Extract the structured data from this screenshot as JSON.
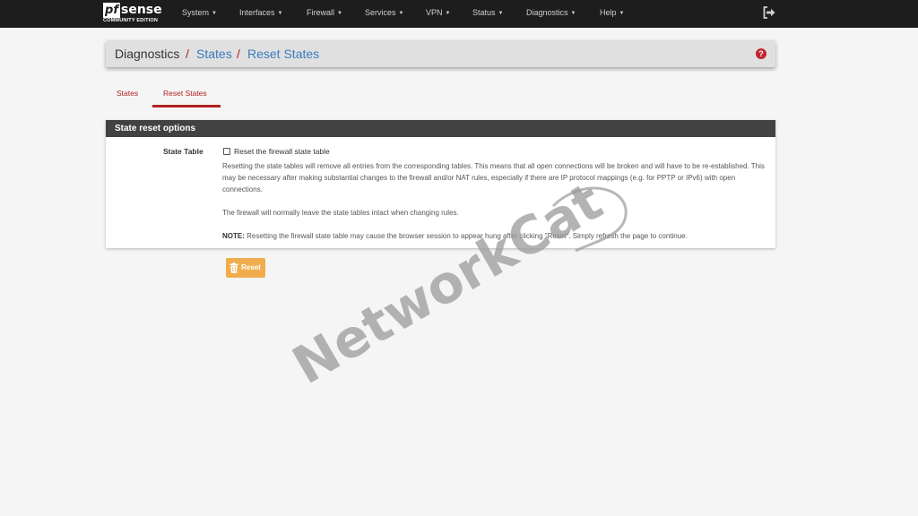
{
  "navbar": {
    "brand_pf": "pf",
    "brand_sense": "sense",
    "brand_edition": "COMMUNITY EDITION",
    "menu": [
      {
        "label": "System"
      },
      {
        "label": "Interfaces"
      },
      {
        "label": "Firewall"
      },
      {
        "label": "Services"
      },
      {
        "label": "VPN"
      },
      {
        "label": "Status"
      },
      {
        "label": "Diagnostics"
      },
      {
        "label": "Help"
      }
    ],
    "logout_icon": "sign-out-icon"
  },
  "breadcrumb": {
    "items": [
      "Diagnostics",
      "States",
      "Reset States"
    ],
    "separator": "/",
    "help": "?"
  },
  "tabs": [
    {
      "label": "States",
      "active": false
    },
    {
      "label": "Reset States",
      "active": true
    }
  ],
  "panel": {
    "title": "State reset options",
    "field_label": "State Table",
    "checkbox_label": "Reset the firewall state table",
    "checkbox_checked": false,
    "help_p1": "Resetting the state tables will remove all entries from the corresponding tables. This means that all open connections will be broken and will have to be re-established. This may be necessary after making substantial changes to the firewall and/or NAT rules, especially if there are IP protocol mappings (e.g. for PPTP or IPv6) with open connections.",
    "help_p2": "The firewall will normally leave the state tables intact when changing rules.",
    "note_label": "NOTE:",
    "note_text": " Resetting the firewall state table may cause the browser session to appear hung after clicking \"Reset\". Simply refresh the page to continue."
  },
  "reset_button": {
    "label": "Reset",
    "icon": "trash-icon"
  },
  "watermark": {
    "text": "NetworkCat"
  },
  "colors": {
    "navbar_bg": "#1d1d1d",
    "accent_red": "#b22222",
    "link_blue": "#3a7bbf",
    "panel_heading": "#424242",
    "warning_btn": "#f0ad4e"
  }
}
